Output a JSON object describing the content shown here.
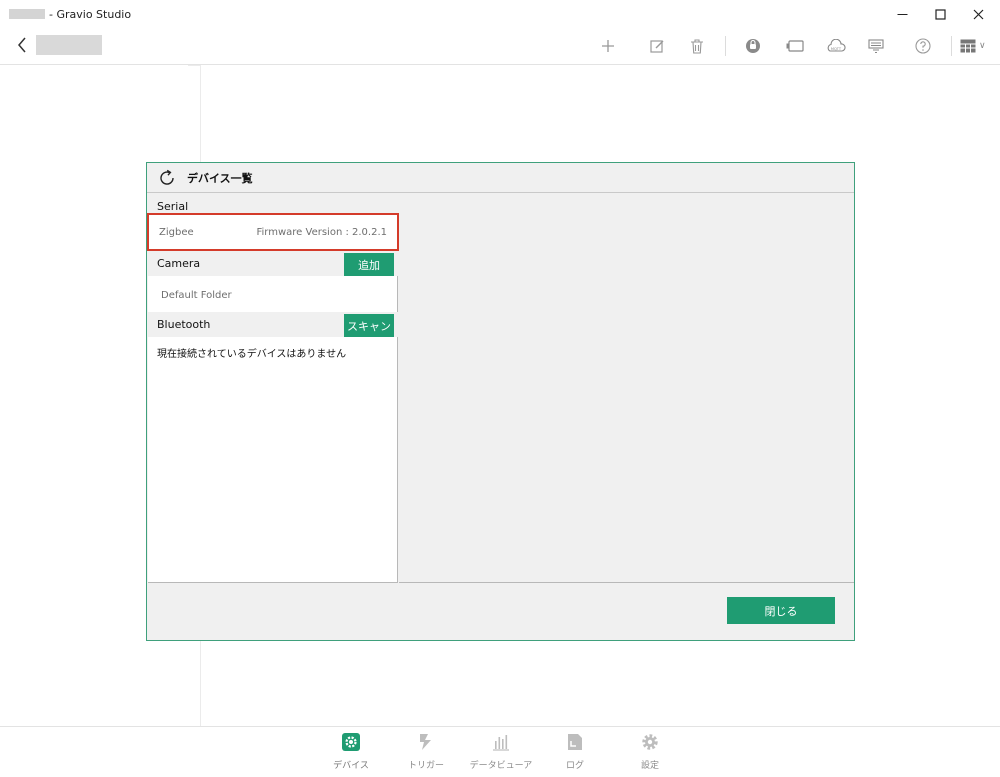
{
  "window": {
    "title": "- Gravio Studio",
    "controls": {
      "minimize": "minimize-icon",
      "maximize": "maximize-icon",
      "close": "close-icon"
    }
  },
  "toolbar": {
    "icons": [
      "back-icon",
      "add-icon",
      "edit-icon",
      "delete-icon",
      "capsule-icon",
      "device-icon",
      "mqtt-icon",
      "settings-panel-icon",
      "help-icon",
      "layout-icon"
    ],
    "mqtt_label": "MQTT",
    "layout_chevron": "∨"
  },
  "dialog": {
    "title": "デバイス一覧",
    "sections": {
      "serial": {
        "label": "Serial",
        "items": [
          {
            "name": "Zigbee",
            "firmware": "Firmware Version : 2.0.2.1"
          }
        ]
      },
      "camera": {
        "label": "Camera",
        "button": "追加",
        "items": [
          {
            "name": "Default Folder"
          }
        ]
      },
      "bluetooth": {
        "label": "Bluetooth",
        "button": "スキャン",
        "empty_message": "現在接続されているデバイスはありません"
      }
    },
    "close_button": "閉じる"
  },
  "bottom_nav": [
    {
      "label": "デバイス",
      "icon": "device-gear-icon",
      "active": true
    },
    {
      "label": "トリガー",
      "icon": "trigger-icon",
      "active": false
    },
    {
      "label": "データビューア",
      "icon": "chart-icon",
      "active": false
    },
    {
      "label": "ログ",
      "icon": "log-icon",
      "active": false
    },
    {
      "label": "設定",
      "icon": "settings-icon",
      "active": false
    }
  ],
  "colors": {
    "accent": "#1f9c72",
    "dialog_border": "#3fa07c",
    "highlight_border": "#d43b2a"
  }
}
